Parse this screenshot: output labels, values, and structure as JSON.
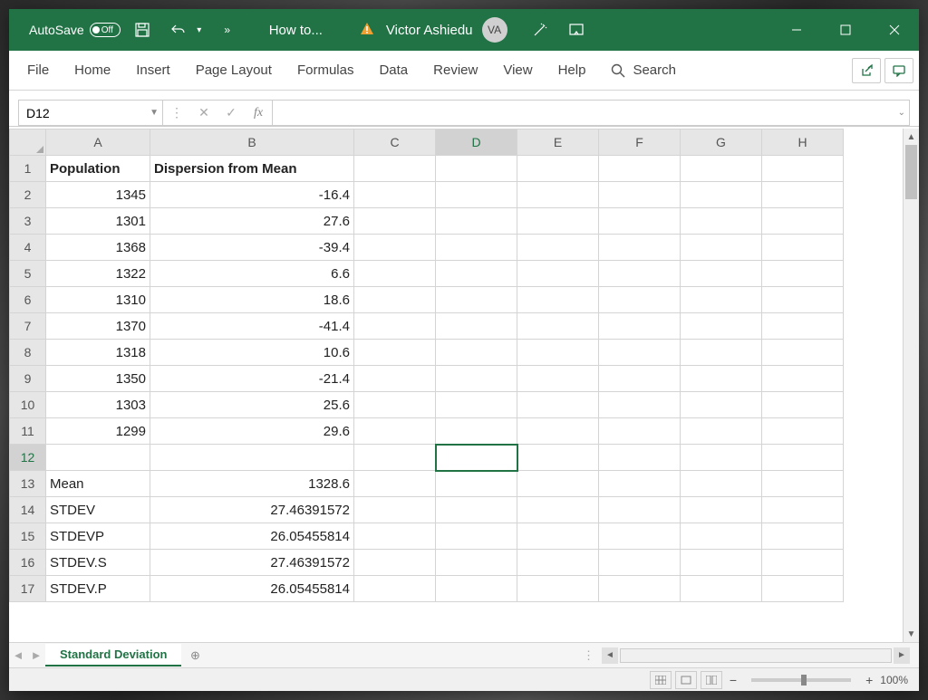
{
  "titlebar": {
    "autosave_label": "AutoSave",
    "autosave_state": "Off",
    "doc_title": "How to...",
    "user_name": "Victor Ashiedu",
    "user_initials": "VA"
  },
  "ribbon": {
    "tabs": [
      "File",
      "Home",
      "Insert",
      "Page Layout",
      "Formulas",
      "Data",
      "Review",
      "View",
      "Help"
    ],
    "search_label": "Search"
  },
  "formulabar": {
    "cell_ref": "D12",
    "formula": ""
  },
  "grid": {
    "columns": [
      "A",
      "B",
      "C",
      "D",
      "E",
      "F",
      "G",
      "H"
    ],
    "selected_cell": "D12",
    "rows": [
      {
        "n": 1,
        "A": "Population",
        "B": "Dispersion from Mean",
        "bold": true,
        "a_align": "left",
        "b_align": "left"
      },
      {
        "n": 2,
        "A": "1345",
        "B": "-16.4"
      },
      {
        "n": 3,
        "A": "1301",
        "B": "27.6"
      },
      {
        "n": 4,
        "A": "1368",
        "B": "-39.4"
      },
      {
        "n": 5,
        "A": "1322",
        "B": "6.6"
      },
      {
        "n": 6,
        "A": "1310",
        "B": "18.6"
      },
      {
        "n": 7,
        "A": "1370",
        "B": "-41.4"
      },
      {
        "n": 8,
        "A": "1318",
        "B": "10.6"
      },
      {
        "n": 9,
        "A": "1350",
        "B": "-21.4"
      },
      {
        "n": 10,
        "A": "1303",
        "B": "25.6"
      },
      {
        "n": 11,
        "A": "1299",
        "B": "29.6"
      },
      {
        "n": 12,
        "A": "",
        "B": ""
      },
      {
        "n": 13,
        "A": "Mean",
        "B": "1328.6",
        "a_align": "left"
      },
      {
        "n": 14,
        "A": "STDEV",
        "B": "27.46391572",
        "a_align": "left"
      },
      {
        "n": 15,
        "A": "STDEVP",
        "B": "26.05455814",
        "a_align": "left"
      },
      {
        "n": 16,
        "A": "STDEV.S",
        "B": "27.46391572",
        "a_align": "left"
      },
      {
        "n": 17,
        "A": "STDEV.P",
        "B": "26.05455814",
        "a_align": "left"
      }
    ]
  },
  "tabs": {
    "sheet_name": "Standard Deviation"
  },
  "statusbar": {
    "zoom": "100%"
  }
}
